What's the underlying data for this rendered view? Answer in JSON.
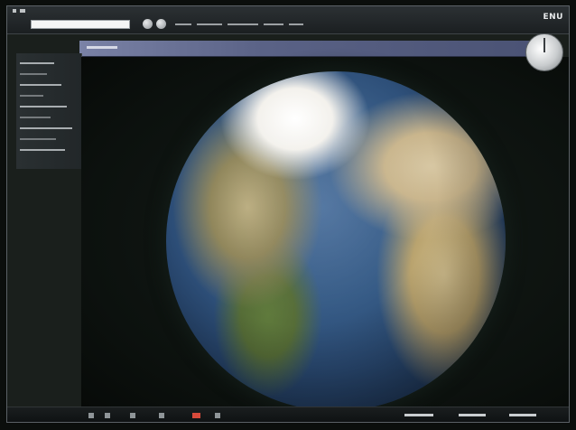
{
  "titlebar": {
    "lang_label": "ENU",
    "search": {
      "value": "",
      "placeholder": ""
    }
  },
  "icons": {
    "globe": "globe-icon",
    "compass": "compass-icon",
    "search": "search-field",
    "navigation": [
      "nav-back-icon",
      "nav-up-icon",
      "nav-forward-icon",
      "nav-home-icon",
      "nav-zoom-icon"
    ]
  },
  "colors": {
    "accent": "#d64a3b",
    "header_strip": "#6a729a",
    "ocean": "#2a4a73",
    "background": "#0b0e0c"
  }
}
